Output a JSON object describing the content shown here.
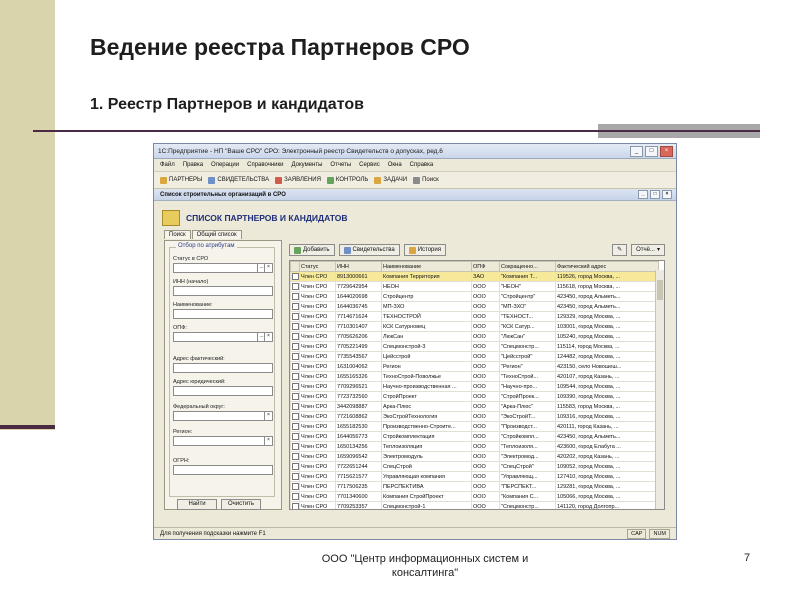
{
  "slide": {
    "title": "Ведение реестра Партнеров СРО",
    "subtitle": "1. Реестр Партнеров и кандидатов",
    "footer_line1": "ООО \"Центр информационных систем и",
    "footer_line2": "консалтинга\"",
    "page_number": "7"
  },
  "window": {
    "title": "1С:Предприятие - НП \"Ваше СРО\" СРО: Электронный реестр Свидетельств о допусках, ред.6",
    "menu": [
      "Файл",
      "Правка",
      "Операции",
      "Справочники",
      "Документы",
      "Отчеты",
      "Сервис",
      "Окна",
      "Справка"
    ],
    "toolbar": [
      "ПАРТНЕРЫ",
      "СВИДЕТЕЛЬСТВА",
      "ЗАЯВЛЕНИЯ",
      "КОНТРОЛЬ",
      "ЗАДАЧИ",
      "Поиск"
    ],
    "subwindow_title": "Список строительных организаций в СРО",
    "form_title": "СПИСОК ПАРТНЕРОВ И КАНДИДАТОВ",
    "tabs": [
      "Поиск",
      "Общий список"
    ],
    "filter_group": "Отбор по атрибутам",
    "filters": [
      "Статус в СРО",
      "ИНН (начало)",
      "Наименование:",
      "ОПФ:",
      "Адрес фактический:",
      "Адрес юридический:",
      "Федеральный округ:",
      "Регион:",
      "ОГРН:"
    ],
    "find_button": "Найти",
    "clear_button": "Очистить",
    "actions": [
      "Добавить",
      "Свидетельства",
      "История"
    ],
    "actions_right": "Отчё...",
    "columns": [
      "",
      "Статус",
      "ИНН",
      "Наименование",
      "ОПФ",
      "Сокращенно...",
      "Фактический адрес"
    ],
    "rows": [
      [
        "Член СРО",
        "8913000661",
        "Компания Территория",
        "ЗАО",
        "\"Компания Т...",
        "119526, город Москва, ..."
      ],
      [
        "Член СРО",
        "7729642954",
        "НЕОН",
        "ООО",
        "\"НЕОН\"",
        "115618, город Москва, ..."
      ],
      [
        "Член СРО",
        "1644020698",
        "Стройцентр",
        "ООО",
        "\"Стройцентр\"",
        "423450, город Альметь..."
      ],
      [
        "Член СРО",
        "1644036745",
        "МП-ЗХО",
        "ООО",
        "\"МП-ЗХО\"",
        "423450, город Альметь..."
      ],
      [
        "Член СРО",
        "7714671624",
        "ТЕХНОСТРОЙ",
        "ООО",
        "\"ТЕХНОСТ...",
        "129329, город Москва, ..."
      ],
      [
        "Член СРО",
        "7710301407",
        "КСК Сатурновец",
        "ООО",
        "\"КСК Сатур...",
        "103001, город Москва, ..."
      ],
      [
        "Член СРО",
        "7705626206",
        "ЛюкСан",
        "ООО",
        "\"ЛюкСан\"",
        "105240, город Москва, ..."
      ],
      [
        "Член СРО",
        "7705221499",
        "Спецмонстрой-3",
        "ООО",
        "\"Спецмонстр...",
        "115114, город Москва, ..."
      ],
      [
        "Член СРО",
        "7735543567",
        "Цейсстрой",
        "ООО",
        "\"Цейсстрой\"",
        "124482, город Москва, ..."
      ],
      [
        "Член СРО",
        "1631004062",
        "Регион",
        "ООО",
        "\"Регион\"",
        "423150, село Новошеш..."
      ],
      [
        "Член СРО",
        "1655165326",
        "ТехноСтрой-Поволжье",
        "ООО",
        "\"ТехноСтрой...",
        "420107, город Казань, ..."
      ],
      [
        "Член СРО",
        "7709296521",
        "Научно-производственная ...",
        "ООО",
        "\"Научно-про...",
        "109544, город Москва, ..."
      ],
      [
        "Член СРО",
        "7723732560",
        "СтройПроект",
        "ООО",
        "\"СтройПроек...",
        "109390, город Москва, ..."
      ],
      [
        "Член СРО",
        "3442098887",
        "Арка-Плюс",
        "ООО",
        "\"Арка-Плюс\"",
        "115583, город Москва, ..."
      ],
      [
        "Член СРО",
        "7721608862",
        "ЭкоСтройТехнология",
        "ООО",
        "\"ЭкоСтройТ...",
        "109316, город Москва, ..."
      ],
      [
        "Член СРО",
        "1655182530",
        "Производственно-Строите...",
        "ООО",
        "\"Производст...",
        "420111, город Казань, ..."
      ],
      [
        "Член СРО",
        "1644056773",
        "Стройкомплектация",
        "ООО",
        "\"Стройкомпл...",
        "423450, город Альметь..."
      ],
      [
        "Член СРО",
        "1650134256",
        "Теплоизоляция",
        "ООО",
        "\"Теплоизоля...",
        "423600, город Елабуга ..."
      ],
      [
        "Член СРО",
        "1659096542",
        "Электромодуль",
        "ООО",
        "\"Электромод...",
        "420202, город Казань, ..."
      ],
      [
        "Член СРО",
        "7722651244",
        "СпецСтрой",
        "ООО",
        "\"СпецСтрой\"",
        "109052, город Москва, ..."
      ],
      [
        "Член СРО",
        "7715621577",
        "Управляющая компания",
        "ООО",
        "\"Управляющ...",
        "127410, город Москва, ..."
      ],
      [
        "Член СРО",
        "7717506235",
        "ПЕРСПЕКТИВА",
        "ООО",
        "\"ПЕРСПЕКТ...",
        "129281, город Москва, ..."
      ],
      [
        "Член СРО",
        "7701340600",
        "Компания СтройПроект",
        "ООО",
        "\"Компания С...",
        "105066, город Москва, ..."
      ],
      [
        "Член СРО",
        "7709253357",
        "Спецмонстрой-1",
        "ООО",
        "\"Спецмонстр...",
        "141120, город Долгопр..."
      ]
    ],
    "status_text": "Для получения подсказки нажмите F1",
    "status_indicators": [
      "CAP",
      "NUM"
    ]
  }
}
